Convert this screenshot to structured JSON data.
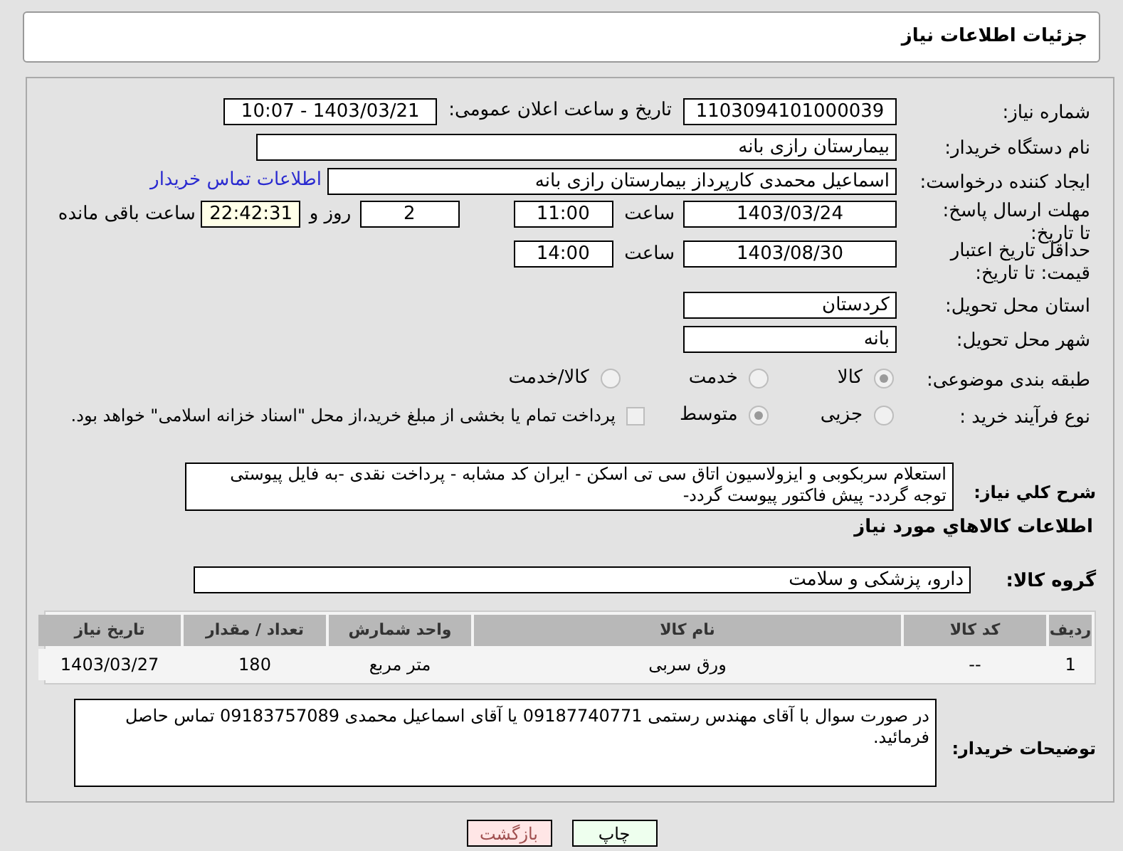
{
  "header": {
    "title": "جزئیات اطلاعات نیاز"
  },
  "need_number": {
    "label": "شماره نیاز:",
    "value": "1103094101000039"
  },
  "announce_date": {
    "label": "تاریخ و ساعت اعلان عمومی:",
    "value": "1403/03/21 - 10:07"
  },
  "buyer_org": {
    "label": "نام دستگاه خریدار:",
    "value": "بیمارستان رازی بانه"
  },
  "requester": {
    "label": "ایجاد کننده درخواست:",
    "value": "اسماعیل محمدی کارپرداز بیمارستان رازی بانه",
    "link": "اطلاعات تماس خریدار"
  },
  "response_deadline": {
    "label": "مهلت ارسال پاسخ: تا تاریخ:",
    "date": "1403/03/24",
    "time_label": "ساعت",
    "time": "11:00",
    "days": "2",
    "days_label": "روز و",
    "remaining": "22:42:31",
    "remaining_label": "ساعت باقی مانده"
  },
  "price_validity": {
    "label": "حداقل تاریخ اعتبار قیمت: تا تاریخ:",
    "date": "1403/08/30",
    "time_label": "ساعت",
    "time": "14:00"
  },
  "province": {
    "label": "استان محل تحویل:",
    "value": "کردستان"
  },
  "city": {
    "label": "شهر محل تحویل:",
    "value": "بانه"
  },
  "category": {
    "label": "طبقه بندی موضوعی:",
    "options": [
      {
        "label": "کالا",
        "selected": true
      },
      {
        "label": "خدمت",
        "selected": false
      },
      {
        "label": "کالا/خدمت",
        "selected": false
      }
    ]
  },
  "process": {
    "label": "نوع فرآیند خرید :",
    "options": [
      {
        "label": "جزیی",
        "selected": false
      },
      {
        "label": "متوسط",
        "selected": true
      }
    ],
    "payment": {
      "label": "پرداخت تمام یا بخشی از مبلغ خرید،از محل \"اسناد خزانه اسلامی\" خواهد بود.",
      "checked": false
    }
  },
  "description": {
    "label": "شرح کلي نياز:",
    "value": "استعلام سربکوبی و ایزولاسیون اتاق سی تی اسکن  - ایران کد مشابه - پرداخت نقدی -به فایل پیوستی توجه گردد- پیش فاکتور پیوست گردد-"
  },
  "goods_title": "اطلاعات کالاهاي مورد نياز",
  "goods_group": {
    "label": "گروه کالا:",
    "value": "دارو، پزشکی و سلامت"
  },
  "table": {
    "columns": [
      "ردیف",
      "کد کالا",
      "نام کالا",
      "واحد شمارش",
      "تعداد / مقدار",
      "تاریخ نیاز"
    ],
    "rows": [
      [
        "1",
        "--",
        "ورق سربی",
        "متر مربع",
        "180",
        "1403/03/27"
      ]
    ]
  },
  "buyer_notes": {
    "label": "توضیحات خریدار:",
    "value": "در صورت سوال با آقای مهندس رستمی 09187740771 یا آقای اسماعیل محمدی 09183757089  تماس حاصل فرمائید."
  },
  "buttons": [
    {
      "label": "چاپ",
      "kind": "print"
    },
    {
      "label": "بازگشت",
      "kind": "back"
    }
  ]
}
